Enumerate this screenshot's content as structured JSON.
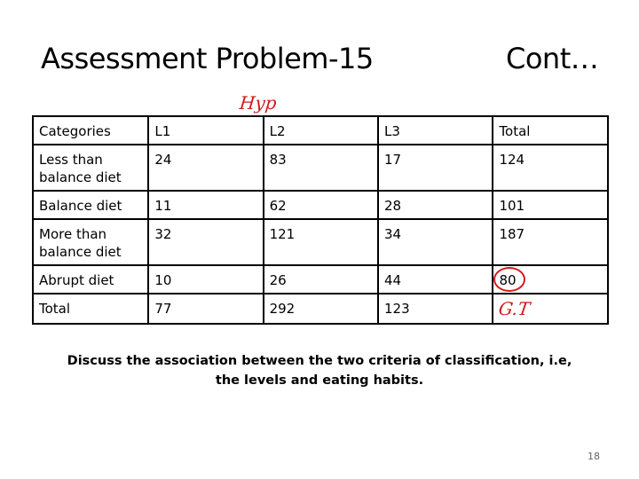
{
  "slide": {
    "title": "Assessment Problem-15",
    "continuation": "Cont…",
    "annotation_top": "Hyp",
    "question_line1": "Discuss the association between the two criteria of classification, i.e,",
    "question_line2": "the levels and eating habits.",
    "page_number": "18"
  },
  "table": {
    "headers": [
      "Categories",
      "L1",
      "L2",
      "L3",
      "Total"
    ],
    "rows": [
      [
        "Less than balance diet",
        "24",
        "83",
        "17",
        "124"
      ],
      [
        "Balance diet",
        "11",
        "62",
        "28",
        "101"
      ],
      [
        "More than balance diet",
        "32",
        "121",
        "34",
        "187"
      ],
      [
        "Abrupt diet",
        "10",
        "26",
        "44",
        "80"
      ],
      [
        "Total",
        "77",
        "292",
        "123",
        ""
      ]
    ],
    "circled_cell": "80",
    "grand_total_annotation": "G.T",
    "annotation_color": "#d11a1a"
  }
}
